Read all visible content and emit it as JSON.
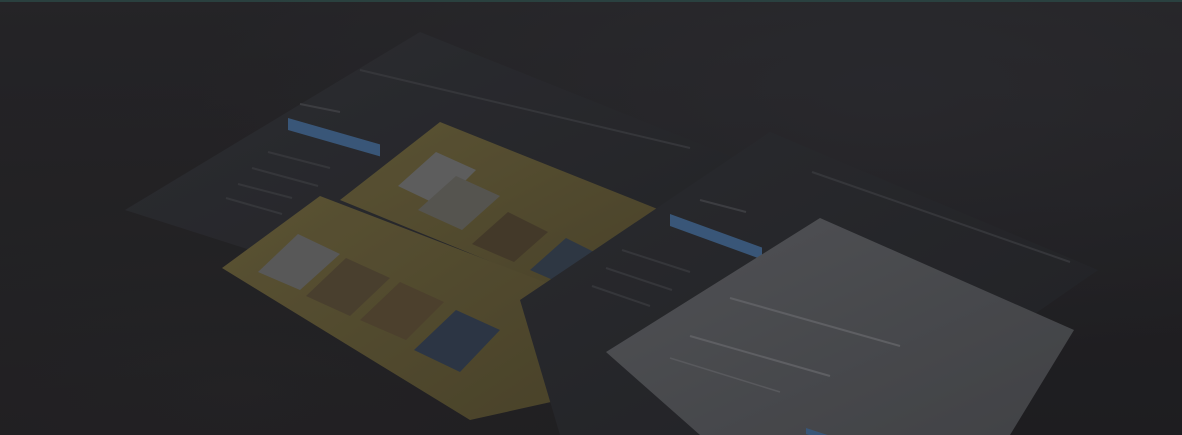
{
  "scene": {
    "description_free": true,
    "colors": {
      "background": "#2b2a2d",
      "panel_dark": "#323338",
      "sidebar": "#2c2d31",
      "accent_blue": "#4f7fb3",
      "card_yellow": "#7b7040",
      "light_panel": "#6a6c70",
      "top_line": "#3b6f68"
    }
  }
}
